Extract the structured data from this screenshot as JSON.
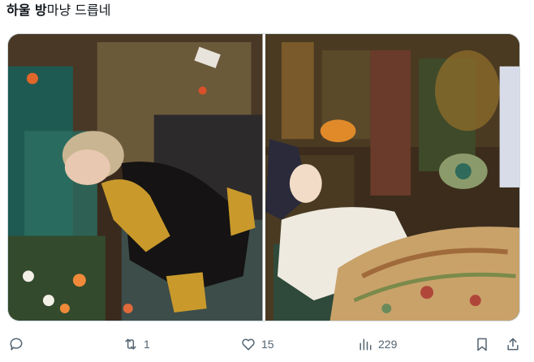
{
  "tweet": {
    "text_bold": "하울 방",
    "text_rest": "마냥 드릅네"
  },
  "media": [
    {
      "name": "photo-left",
      "icon": "photo"
    },
    {
      "name": "photo-right",
      "icon": "photo"
    }
  ],
  "actions": {
    "reply": {
      "icon": "reply-icon",
      "count": ""
    },
    "retweet": {
      "icon": "retweet-icon",
      "count": "1"
    },
    "like": {
      "icon": "heart-icon",
      "count": "15"
    },
    "views": {
      "icon": "bar-chart-icon",
      "count": "229"
    },
    "bookmark": {
      "icon": "bookmark-icon"
    },
    "share": {
      "icon": "share-icon"
    }
  },
  "colors": {
    "icon": "#536471",
    "text": "#0f1419",
    "border": "#cfd9de"
  }
}
